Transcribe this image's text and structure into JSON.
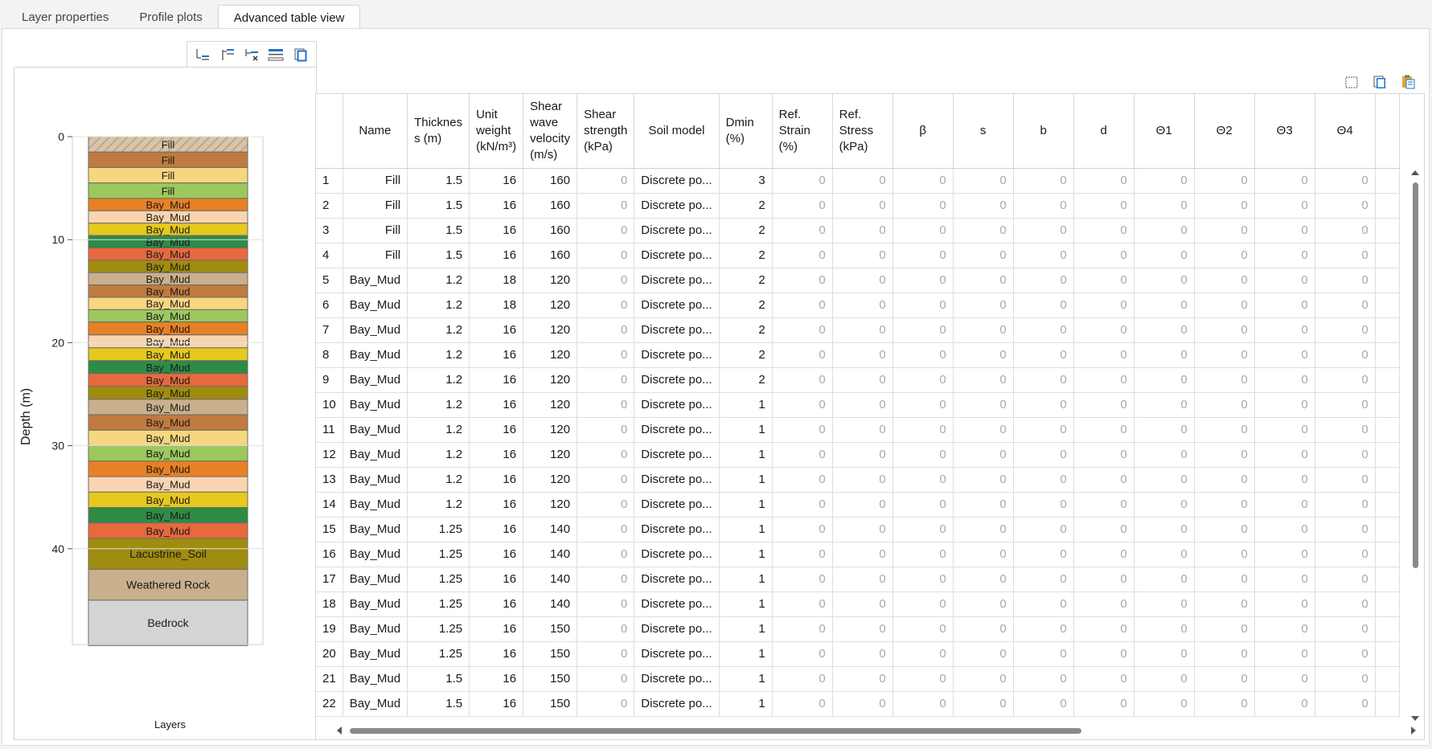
{
  "tabs": [
    "Layer properties",
    "Profile plots",
    "Advanced table view"
  ],
  "active_tab": 2,
  "profile": {
    "y_axis_label": "Depth (m)",
    "x_axis_label": "Layers",
    "ticks": [
      0,
      10,
      20,
      30,
      40
    ],
    "max_depth": 49.3,
    "layers": [
      {
        "name": "Fill",
        "thickness": 1.5,
        "color": "#d8c4a8",
        "hatch": true
      },
      {
        "name": "Fill",
        "thickness": 1.5,
        "color": "#c07a3f"
      },
      {
        "name": "Fill",
        "thickness": 1.5,
        "color": "#f6d77f"
      },
      {
        "name": "Fill",
        "thickness": 1.5,
        "color": "#9cc85e"
      },
      {
        "name": "Bay_Mud",
        "thickness": 1.2,
        "color": "#e88125"
      },
      {
        "name": "Bay_Mud",
        "thickness": 1.2,
        "color": "#f8d5b0"
      },
      {
        "name": "Bay_Mud",
        "thickness": 1.2,
        "color": "#e6c81e"
      },
      {
        "name": "Bay_Mud",
        "thickness": 1.2,
        "color": "#2e8b46"
      },
      {
        "name": "Bay_Mud",
        "thickness": 1.2,
        "color": "#e7693d"
      },
      {
        "name": "Bay_Mud",
        "thickness": 1.2,
        "color": "#a08c0e"
      },
      {
        "name": "Bay_Mud",
        "thickness": 1.2,
        "color": "#c9b08c"
      },
      {
        "name": "Bay_Mud",
        "thickness": 1.2,
        "color": "#c07a3f"
      },
      {
        "name": "Bay_Mud",
        "thickness": 1.2,
        "color": "#f6d77f"
      },
      {
        "name": "Bay_Mud",
        "thickness": 1.2,
        "color": "#9cc85e"
      },
      {
        "name": "Bay_Mud",
        "thickness": 1.25,
        "color": "#e88125"
      },
      {
        "name": "Bay_Mud",
        "thickness": 1.25,
        "color": "#f8d5b0"
      },
      {
        "name": "Bay_Mud",
        "thickness": 1.25,
        "color": "#e6c81e"
      },
      {
        "name": "Bay_Mud",
        "thickness": 1.25,
        "color": "#2e8b46"
      },
      {
        "name": "Bay_Mud",
        "thickness": 1.25,
        "color": "#e7693d"
      },
      {
        "name": "Bay_Mud",
        "thickness": 1.25,
        "color": "#a08c0e"
      },
      {
        "name": "Bay_Mud",
        "thickness": 1.5,
        "color": "#c9b08c"
      },
      {
        "name": "Bay_Mud",
        "thickness": 1.5,
        "color": "#c07a3f"
      },
      {
        "name": "Bay_Mud",
        "thickness": 1.5,
        "color": "#f6d77f"
      },
      {
        "name": "Bay_Mud",
        "thickness": 1.5,
        "color": "#9cc85e"
      },
      {
        "name": "Bay_Mud",
        "thickness": 1.5,
        "color": "#e88125"
      },
      {
        "name": "Bay_Mud",
        "thickness": 1.5,
        "color": "#f8d5b0"
      },
      {
        "name": "Bay_Mud",
        "thickness": 1.5,
        "color": "#e6c81e"
      },
      {
        "name": "Bay_Mud",
        "thickness": 1.5,
        "color": "#2e8b46"
      },
      {
        "name": "Bay_Mud",
        "thickness": 1.5,
        "color": "#e7693d"
      },
      {
        "name": "Lacustrine_Soil",
        "thickness": 3.0,
        "color": "#a08c0e"
      },
      {
        "name": "Weathered Rock",
        "thickness": 3.0,
        "color": "#c9b08c"
      },
      {
        "name": "Bedrock",
        "thickness": 4.4,
        "color": "#d4d4d4"
      }
    ]
  },
  "table": {
    "columns": [
      {
        "key": "idx",
        "label": ""
      },
      {
        "key": "name",
        "label": "Name"
      },
      {
        "key": "thickness",
        "label": "Thicknes s (m)"
      },
      {
        "key": "unit_weight",
        "label": "Unit weight (kN/m³)"
      },
      {
        "key": "vs",
        "label": "Shear wave velocity (m/s)"
      },
      {
        "key": "strength",
        "label": "Shear strength (kPa)"
      },
      {
        "key": "soil_model",
        "label": "Soil model"
      },
      {
        "key": "dmin",
        "label": "Dmin (%)"
      },
      {
        "key": "ref_strain",
        "label": "Ref. Strain (%)"
      },
      {
        "key": "ref_stress",
        "label": "Ref. Stress (kPa)"
      },
      {
        "key": "beta",
        "label": "β"
      },
      {
        "key": "s",
        "label": "s"
      },
      {
        "key": "b",
        "label": "b"
      },
      {
        "key": "d",
        "label": "d"
      },
      {
        "key": "t1",
        "label": "Θ1"
      },
      {
        "key": "t2",
        "label": "Θ2"
      },
      {
        "key": "t3",
        "label": "Θ3"
      },
      {
        "key": "t4",
        "label": "Θ4"
      },
      {
        "key": "extra",
        "label": ""
      }
    ],
    "rows": [
      [
        "1",
        "Fill",
        "1.5",
        "16",
        "160",
        "0",
        "Discrete po...",
        "3",
        "0",
        "0",
        "0",
        "0",
        "0",
        "0",
        "0",
        "0",
        "0",
        "0"
      ],
      [
        "2",
        "Fill",
        "1.5",
        "16",
        "160",
        "0",
        "Discrete po...",
        "2",
        "0",
        "0",
        "0",
        "0",
        "0",
        "0",
        "0",
        "0",
        "0",
        "0"
      ],
      [
        "3",
        "Fill",
        "1.5",
        "16",
        "160",
        "0",
        "Discrete po...",
        "2",
        "0",
        "0",
        "0",
        "0",
        "0",
        "0",
        "0",
        "0",
        "0",
        "0"
      ],
      [
        "4",
        "Fill",
        "1.5",
        "16",
        "160",
        "0",
        "Discrete po...",
        "2",
        "0",
        "0",
        "0",
        "0",
        "0",
        "0",
        "0",
        "0",
        "0",
        "0"
      ],
      [
        "5",
        "Bay_Mud",
        "1.2",
        "18",
        "120",
        "0",
        "Discrete po...",
        "2",
        "0",
        "0",
        "0",
        "0",
        "0",
        "0",
        "0",
        "0",
        "0",
        "0"
      ],
      [
        "6",
        "Bay_Mud",
        "1.2",
        "18",
        "120",
        "0",
        "Discrete po...",
        "2",
        "0",
        "0",
        "0",
        "0",
        "0",
        "0",
        "0",
        "0",
        "0",
        "0"
      ],
      [
        "7",
        "Bay_Mud",
        "1.2",
        "16",
        "120",
        "0",
        "Discrete po...",
        "2",
        "0",
        "0",
        "0",
        "0",
        "0",
        "0",
        "0",
        "0",
        "0",
        "0"
      ],
      [
        "8",
        "Bay_Mud",
        "1.2",
        "16",
        "120",
        "0",
        "Discrete po...",
        "2",
        "0",
        "0",
        "0",
        "0",
        "0",
        "0",
        "0",
        "0",
        "0",
        "0"
      ],
      [
        "9",
        "Bay_Mud",
        "1.2",
        "16",
        "120",
        "0",
        "Discrete po...",
        "2",
        "0",
        "0",
        "0",
        "0",
        "0",
        "0",
        "0",
        "0",
        "0",
        "0"
      ],
      [
        "10",
        "Bay_Mud",
        "1.2",
        "16",
        "120",
        "0",
        "Discrete po...",
        "1",
        "0",
        "0",
        "0",
        "0",
        "0",
        "0",
        "0",
        "0",
        "0",
        "0"
      ],
      [
        "11",
        "Bay_Mud",
        "1.2",
        "16",
        "120",
        "0",
        "Discrete po...",
        "1",
        "0",
        "0",
        "0",
        "0",
        "0",
        "0",
        "0",
        "0",
        "0",
        "0"
      ],
      [
        "12",
        "Bay_Mud",
        "1.2",
        "16",
        "120",
        "0",
        "Discrete po...",
        "1",
        "0",
        "0",
        "0",
        "0",
        "0",
        "0",
        "0",
        "0",
        "0",
        "0"
      ],
      [
        "13",
        "Bay_Mud",
        "1.2",
        "16",
        "120",
        "0",
        "Discrete po...",
        "1",
        "0",
        "0",
        "0",
        "0",
        "0",
        "0",
        "0",
        "0",
        "0",
        "0"
      ],
      [
        "14",
        "Bay_Mud",
        "1.2",
        "16",
        "120",
        "0",
        "Discrete po...",
        "1",
        "0",
        "0",
        "0",
        "0",
        "0",
        "0",
        "0",
        "0",
        "0",
        "0"
      ],
      [
        "15",
        "Bay_Mud",
        "1.25",
        "16",
        "140",
        "0",
        "Discrete po...",
        "1",
        "0",
        "0",
        "0",
        "0",
        "0",
        "0",
        "0",
        "0",
        "0",
        "0"
      ],
      [
        "16",
        "Bay_Mud",
        "1.25",
        "16",
        "140",
        "0",
        "Discrete po...",
        "1",
        "0",
        "0",
        "0",
        "0",
        "0",
        "0",
        "0",
        "0",
        "0",
        "0"
      ],
      [
        "17",
        "Bay_Mud",
        "1.25",
        "16",
        "140",
        "0",
        "Discrete po...",
        "1",
        "0",
        "0",
        "0",
        "0",
        "0",
        "0",
        "0",
        "0",
        "0",
        "0"
      ],
      [
        "18",
        "Bay_Mud",
        "1.25",
        "16",
        "140",
        "0",
        "Discrete po...",
        "1",
        "0",
        "0",
        "0",
        "0",
        "0",
        "0",
        "0",
        "0",
        "0",
        "0"
      ],
      [
        "19",
        "Bay_Mud",
        "1.25",
        "16",
        "150",
        "0",
        "Discrete po...",
        "1",
        "0",
        "0",
        "0",
        "0",
        "0",
        "0",
        "0",
        "0",
        "0",
        "0"
      ],
      [
        "20",
        "Bay_Mud",
        "1.25",
        "16",
        "150",
        "0",
        "Discrete po...",
        "1",
        "0",
        "0",
        "0",
        "0",
        "0",
        "0",
        "0",
        "0",
        "0",
        "0"
      ],
      [
        "21",
        "Bay_Mud",
        "1.5",
        "16",
        "150",
        "0",
        "Discrete po...",
        "1",
        "0",
        "0",
        "0",
        "0",
        "0",
        "0",
        "0",
        "0",
        "0",
        "0"
      ],
      [
        "22",
        "Bay_Mud",
        "1.5",
        "16",
        "150",
        "0",
        "Discrete po...",
        "1",
        "0",
        "0",
        "0",
        "0",
        "0",
        "0",
        "0",
        "0",
        "0",
        "0"
      ]
    ]
  },
  "colors": {
    "accent": "#1e73c8",
    "muted_text": "#a9a9a9"
  },
  "icons": {
    "left_toolbar": [
      "insert-row-below-icon",
      "insert-row-above-icon",
      "delete-row-icon",
      "merge-rows-icon",
      "copy-icon"
    ],
    "right_toolbar": [
      "select-all-icon",
      "copy-icon",
      "paste-icon"
    ]
  }
}
